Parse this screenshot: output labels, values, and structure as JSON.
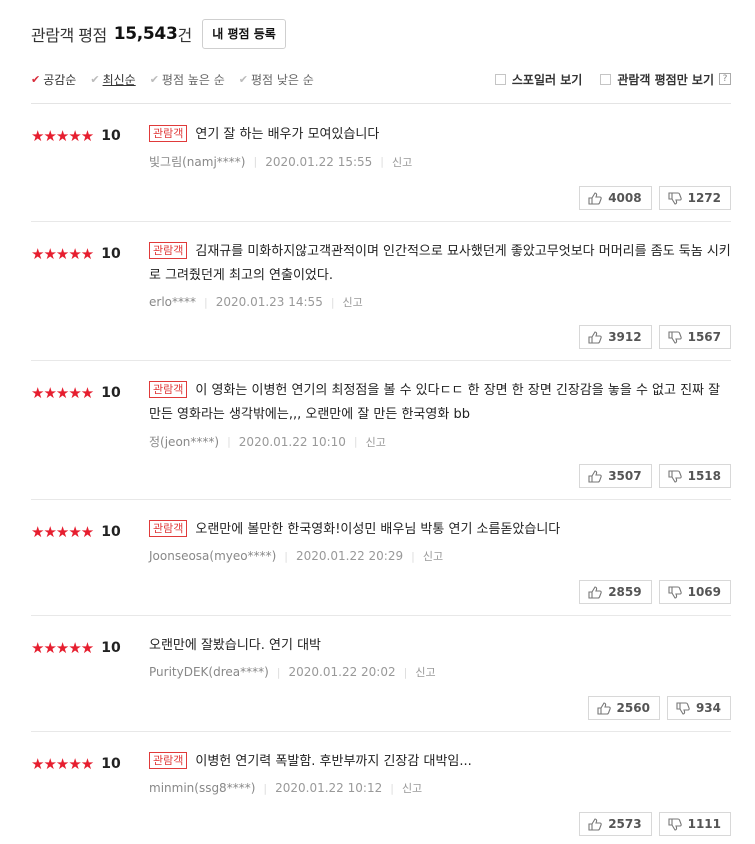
{
  "header": {
    "title": "관람객 평점",
    "count": "15,543",
    "unit": "건",
    "register_button": "내 평점 등록"
  },
  "sort": {
    "options": [
      {
        "label": "공감순",
        "active": true
      },
      {
        "label": "최신순",
        "underline": true
      },
      {
        "label": "평점 높은 순"
      },
      {
        "label": "평점 낮은 순"
      }
    ],
    "spoiler_label": "스포일러 보기",
    "viewer_only_label": "관람객 평점만 보기",
    "help": "?"
  },
  "colors": {
    "star": "#e61e2f",
    "tag": "#e03a3a"
  },
  "reviews": [
    {
      "score": "10",
      "stars": "★★★★★",
      "tag": "관람객",
      "text": "연기 잘 하는 배우가 모여있습니다",
      "author": "빛그림(namj****)",
      "date": "2020.01.22 15:55",
      "report": "신고",
      "likes": "4008",
      "dislikes": "1272"
    },
    {
      "score": "10",
      "stars": "★★★★★",
      "tag": "관람객",
      "text": "김재규를 미화하지않고객관적이며 인간적으로 묘사했던게 좋았고무엇보다 머머리를 좀도 둑놈 시키로 그려줬던게 최고의 연출이었다.",
      "author": "erlo****",
      "date": "2020.01.23 14:55",
      "report": "신고",
      "likes": "3912",
      "dislikes": "1567"
    },
    {
      "score": "10",
      "stars": "★★★★★",
      "tag": "관람객",
      "text": "이 영화는 이병헌 연기의 최정점을 볼 수 있다ㄷㄷ 한 장면 한 장면 긴장감을 놓을 수 없고 진짜 잘 만든 영화라는 생각밖에는,,, 오랜만에 잘 만든 한국영화 bb",
      "author": "정(jeon****)",
      "date": "2020.01.22 10:10",
      "report": "신고",
      "likes": "3507",
      "dislikes": "1518"
    },
    {
      "score": "10",
      "stars": "★★★★★",
      "tag": "관람객",
      "text": "오랜만에 볼만한 한국영화!이성민 배우님 박통 연기 소름돋았습니다",
      "author": "Joonseosa(myeo****)",
      "date": "2020.01.22 20:29",
      "report": "신고",
      "likes": "2859",
      "dislikes": "1069"
    },
    {
      "score": "10",
      "stars": "★★★★★",
      "tag": "",
      "text": "오랜만에 잘봤습니다. 연기 대박",
      "author": "PurityDEK(drea****)",
      "date": "2020.01.22 20:02",
      "report": "신고",
      "likes": "2560",
      "dislikes": "934"
    },
    {
      "score": "10",
      "stars": "★★★★★",
      "tag": "관람객",
      "text": "이병헌 연기력 폭발함. 후반부까지 긴장감 대박임...",
      "author": "minmin(ssg8****)",
      "date": "2020.01.22 10:12",
      "report": "신고",
      "likes": "2573",
      "dislikes": "1111"
    }
  ]
}
